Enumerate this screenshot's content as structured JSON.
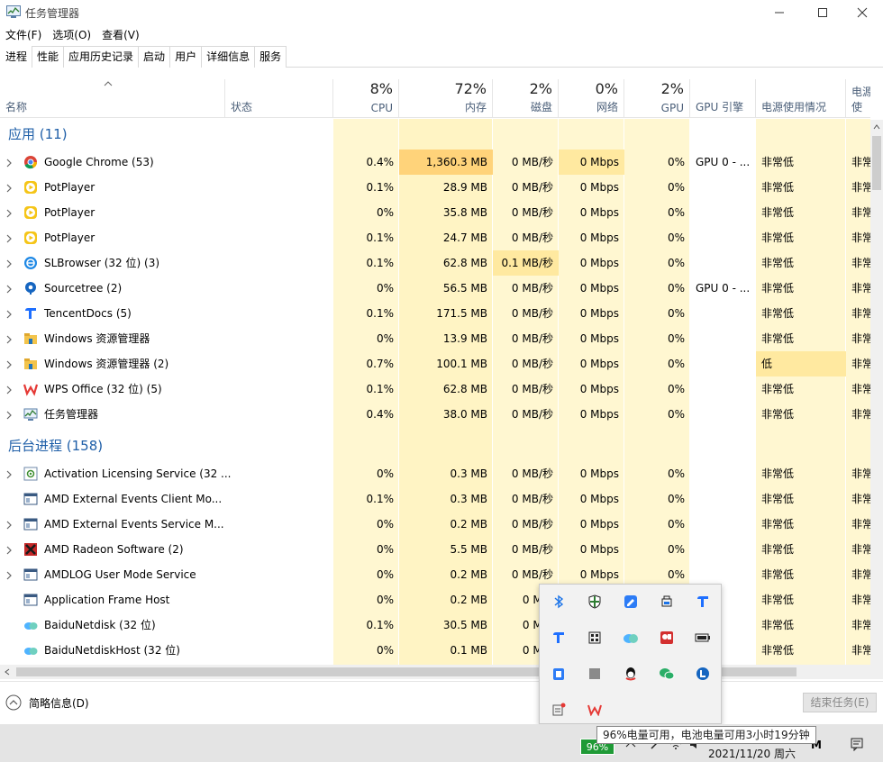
{
  "window": {
    "title": "任务管理器"
  },
  "menu": [
    "文件(F)",
    "选项(O)",
    "查看(V)"
  ],
  "tabs": [
    "进程",
    "性能",
    "应用历史记录",
    "启动",
    "用户",
    "详细信息",
    "服务"
  ],
  "columns": {
    "name": "名称",
    "status": "状态",
    "cpu": {
      "pct": "8%",
      "label": "CPU"
    },
    "memory": {
      "pct": "72%",
      "label": "内存"
    },
    "disk": {
      "pct": "2%",
      "label": "磁盘"
    },
    "network": {
      "pct": "0%",
      "label": "网络"
    },
    "gpu": {
      "pct": "2%",
      "label": "GPU"
    },
    "gpu_engine": "GPU 引擎",
    "power": "电源使用情况",
    "power_trend": "电源使"
  },
  "groups": [
    {
      "label": "应用 (11)"
    },
    {
      "label": "后台进程 (158)"
    }
  ],
  "apps": [
    {
      "icon": "chrome-icon",
      "name": "Google Chrome (53)",
      "cpu": "0.4%",
      "mem": "1,360.3 MB",
      "disk": "0 MB/秒",
      "net": "0 Mbps",
      "gpu": "0%",
      "engine": "GPU 0 - ...",
      "power": "非常低",
      "trend": "非常"
    },
    {
      "icon": "potplayer-icon",
      "name": "PotPlayer",
      "cpu": "0.1%",
      "mem": "28.9 MB",
      "disk": "0 MB/秒",
      "net": "0 Mbps",
      "gpu": "0%",
      "engine": "",
      "power": "非常低",
      "trend": "非常"
    },
    {
      "icon": "potplayer-icon",
      "name": "PotPlayer",
      "cpu": "0%",
      "mem": "35.8 MB",
      "disk": "0 MB/秒",
      "net": "0 Mbps",
      "gpu": "0%",
      "engine": "",
      "power": "非常低",
      "trend": "非常"
    },
    {
      "icon": "potplayer-icon",
      "name": "PotPlayer",
      "cpu": "0.1%",
      "mem": "24.7 MB",
      "disk": "0 MB/秒",
      "net": "0 Mbps",
      "gpu": "0%",
      "engine": "",
      "power": "非常低",
      "trend": "非常"
    },
    {
      "icon": "slbrowser-icon",
      "name": "SLBrowser (32 位) (3)",
      "cpu": "0.1%",
      "mem": "62.8 MB",
      "disk": "0.1 MB/秒",
      "net": "0 Mbps",
      "gpu": "0%",
      "engine": "",
      "power": "非常低",
      "trend": "非常"
    },
    {
      "icon": "sourcetree-icon",
      "name": "Sourcetree (2)",
      "cpu": "0%",
      "mem": "56.5 MB",
      "disk": "0 MB/秒",
      "net": "0 Mbps",
      "gpu": "0%",
      "engine": "GPU 0 - ...",
      "power": "非常低",
      "trend": "非常"
    },
    {
      "icon": "tencentdocs-icon",
      "name": "TencentDocs (5)",
      "cpu": "0.1%",
      "mem": "171.5 MB",
      "disk": "0 MB/秒",
      "net": "0 Mbps",
      "gpu": "0%",
      "engine": "",
      "power": "非常低",
      "trend": "非常"
    },
    {
      "icon": "folder-icon",
      "name": "Windows 资源管理器",
      "cpu": "0%",
      "mem": "13.9 MB",
      "disk": "0 MB/秒",
      "net": "0 Mbps",
      "gpu": "0%",
      "engine": "",
      "power": "非常低",
      "trend": "非常"
    },
    {
      "icon": "folder-icon",
      "name": "Windows 资源管理器 (2)",
      "cpu": "0.7%",
      "mem": "100.1 MB",
      "disk": "0 MB/秒",
      "net": "0 Mbps",
      "gpu": "0%",
      "engine": "",
      "power": "低",
      "trend": "非常"
    },
    {
      "icon": "wps-icon",
      "name": "WPS Office (32 位) (5)",
      "cpu": "0.1%",
      "mem": "62.8 MB",
      "disk": "0 MB/秒",
      "net": "0 Mbps",
      "gpu": "0%",
      "engine": "",
      "power": "非常低",
      "trend": "非常"
    },
    {
      "icon": "taskmgr-icon",
      "name": "任务管理器",
      "cpu": "0.4%",
      "mem": "38.0 MB",
      "disk": "0 MB/秒",
      "net": "0 Mbps",
      "gpu": "0%",
      "engine": "",
      "power": "非常低",
      "trend": "非常"
    }
  ],
  "background": [
    {
      "icon": "service-icon",
      "name": "Activation Licensing Service (32 ...",
      "cpu": "0%",
      "mem": "0.3 MB",
      "disk": "0 MB/秒",
      "net": "0 Mbps",
      "gpu": "0%",
      "engine": "",
      "power": "非常低",
      "trend": "非常",
      "expand": true
    },
    {
      "icon": "window-app-icon",
      "name": "AMD External Events Client Mo...",
      "cpu": "0.1%",
      "mem": "0.3 MB",
      "disk": "0 MB/秒",
      "net": "0 Mbps",
      "gpu": "0%",
      "engine": "",
      "power": "非常低",
      "trend": "非常",
      "expand": false
    },
    {
      "icon": "window-app-icon",
      "name": "AMD External Events Service M...",
      "cpu": "0%",
      "mem": "0.2 MB",
      "disk": "0 MB/秒",
      "net": "0 Mbps",
      "gpu": "0%",
      "engine": "",
      "power": "非常低",
      "trend": "非常",
      "expand": true
    },
    {
      "icon": "amd-radeon-icon",
      "name": "AMD Radeon Software (2)",
      "cpu": "0%",
      "mem": "5.5 MB",
      "disk": "0 MB/秒",
      "net": "0 Mbps",
      "gpu": "0%",
      "engine": "",
      "power": "非常低",
      "trend": "非常",
      "expand": true
    },
    {
      "icon": "window-app-icon",
      "name": "AMDLOG User Mode Service",
      "cpu": "0%",
      "mem": "0.2 MB",
      "disk": "0 MB/秒",
      "net": "0 Mbps",
      "gpu": "0%",
      "engine": "",
      "power": "非常低",
      "trend": "非常",
      "expand": true
    },
    {
      "icon": "window-app-icon",
      "name": "Application Frame Host",
      "cpu": "0%",
      "mem": "0.2 MB",
      "disk": "0 MB/",
      "net": "",
      "gpu": "",
      "engine": "",
      "power": "非常低",
      "trend": "非常",
      "expand": false
    },
    {
      "icon": "baidunetdisk-icon",
      "name": "BaiduNetdisk (32 位)",
      "cpu": "0.1%",
      "mem": "30.5 MB",
      "disk": "0 MB/",
      "net": "",
      "gpu": "",
      "engine": "",
      "power": "非常低",
      "trend": "非常",
      "expand": false
    },
    {
      "icon": "baidunetdisk-icon",
      "name": "BaiduNetdiskHost (32 位)",
      "cpu": "0%",
      "mem": "0.1 MB",
      "disk": "0 MB/",
      "net": "",
      "gpu": "",
      "engine": "",
      "power": "非常低",
      "trend": "非常",
      "expand": false
    }
  ],
  "footer": {
    "brief": "简略信息(D)",
    "end_task": "结束任务(E)"
  },
  "taskbar": {
    "battery": "96%",
    "tooltip": "96%电量可用，电池电量可用3小时19分钟",
    "date": "2021/11/20 周六"
  },
  "colors": {
    "accent": "#1f5fa8",
    "heat_low": "#fff4c4",
    "heat_mid": "#ffe9a0",
    "heat_high": "#ffd37a"
  }
}
